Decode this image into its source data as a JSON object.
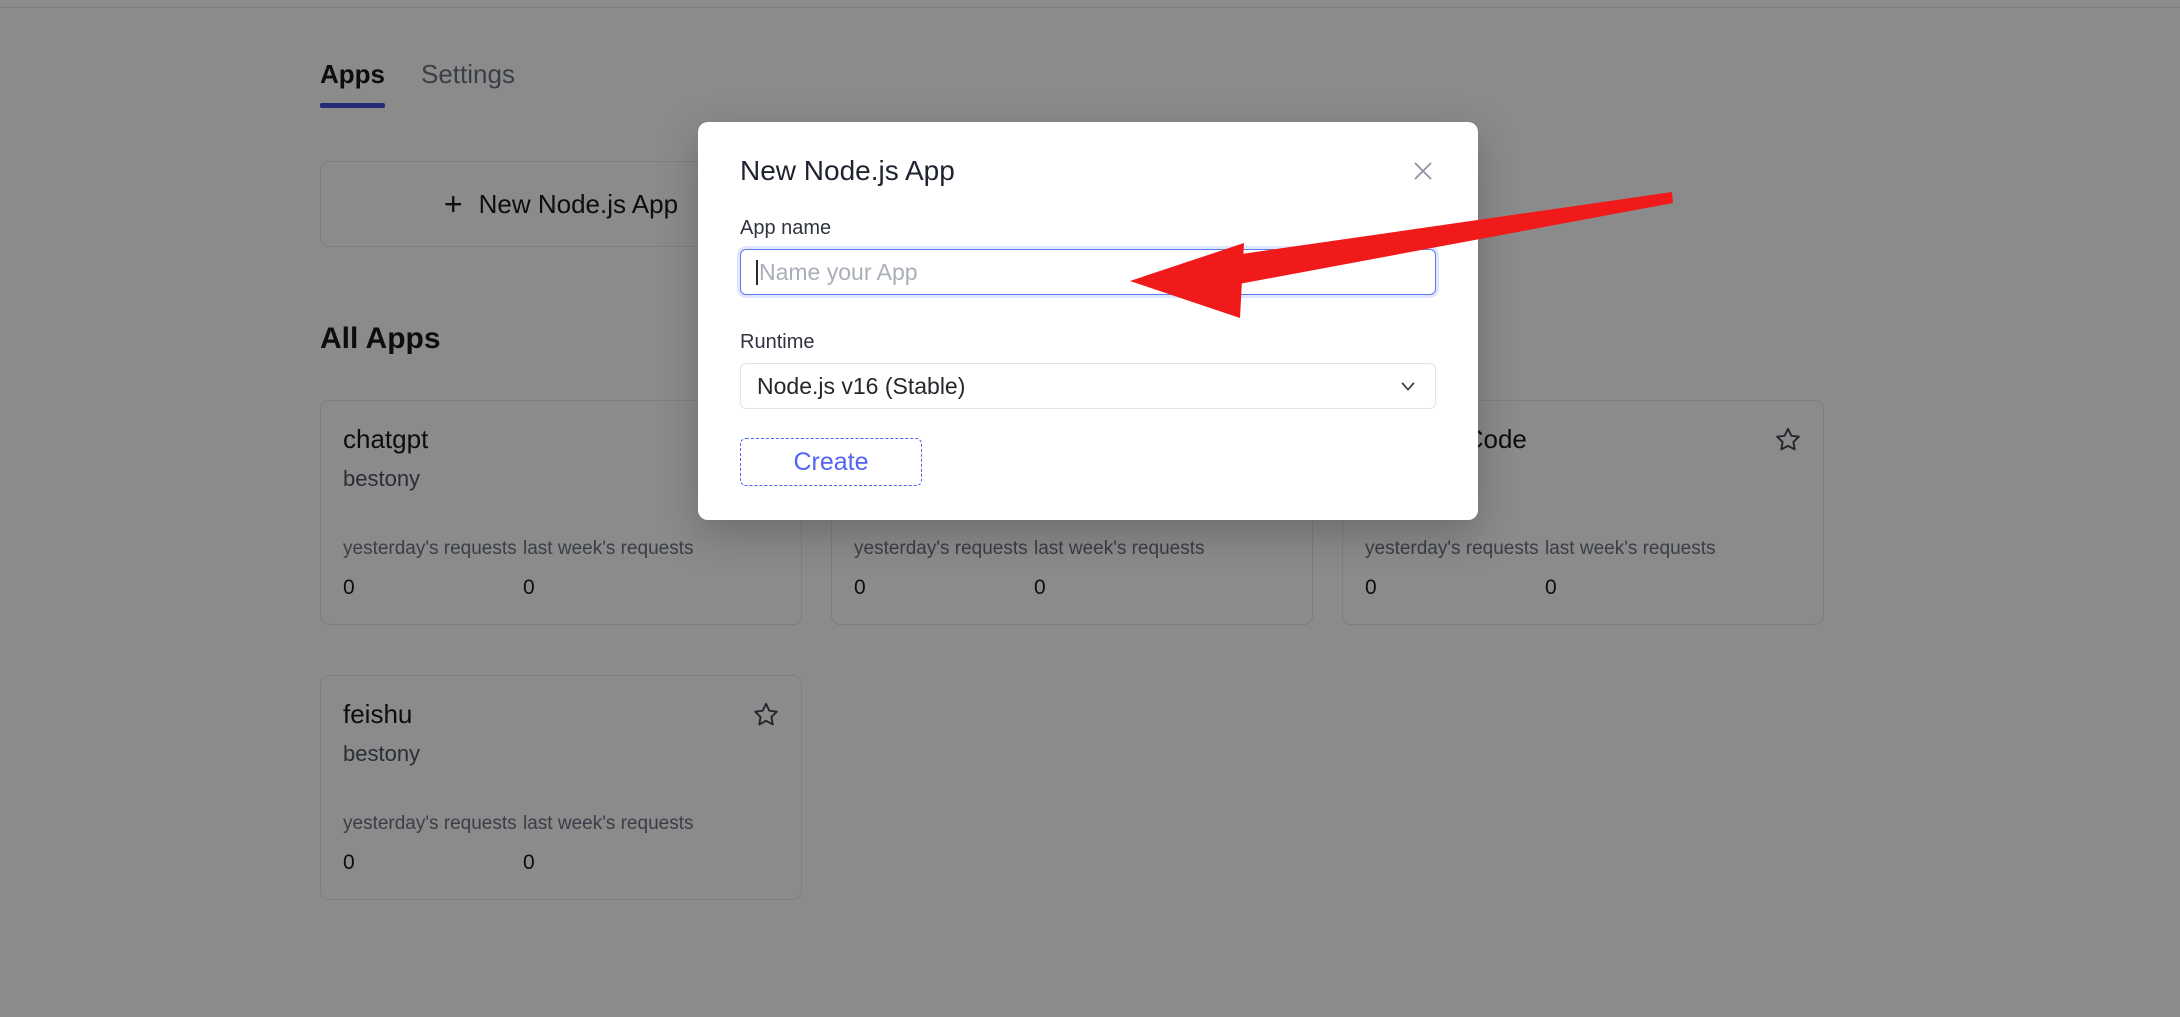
{
  "tabs": [
    {
      "label": "Apps",
      "active": true
    },
    {
      "label": "Settings",
      "active": false
    }
  ],
  "new_app_card": {
    "plus": "+",
    "label": "New Node.js App"
  },
  "section": {
    "title": "All Apps"
  },
  "stat_labels": {
    "yesterday": "yesterday's requests",
    "last_week": "last week's requests"
  },
  "apps": [
    {
      "name": "chatgpt",
      "owner": "bestony",
      "yesterday_requests": "0",
      "last_week_requests": "0",
      "starred": false,
      "star_visible": false
    },
    {
      "name": "",
      "owner": "",
      "yesterday_requests": "0",
      "last_week_requests": "0",
      "starred": false,
      "star_visible": false
    },
    {
      "name": "ial on AirCode",
      "owner": "",
      "yesterday_requests": "0",
      "last_week_requests": "0",
      "starred": false,
      "star_visible": true
    },
    {
      "name": "feishu",
      "owner": "bestony",
      "yesterday_requests": "0",
      "last_week_requests": "0",
      "starred": false,
      "star_visible": true
    }
  ],
  "modal": {
    "title": "New Node.js App",
    "close_label": "×",
    "app_name_label": "App name",
    "app_name_value": "",
    "app_name_placeholder": "Name your App",
    "runtime_label": "Runtime",
    "runtime_value": "Node.js v16 (Stable)",
    "runtime_options": [
      "Node.js v16 (Stable)"
    ],
    "create_label": "Create"
  },
  "annotation": {
    "arrow_color": "#f01a1a",
    "points_to": "app-name-input"
  },
  "colors": {
    "accent": "#4250d8",
    "link": "#5264f6",
    "focus_border": "#5b7cf0",
    "overlay": "rgba(0,0,0,0.455)"
  }
}
